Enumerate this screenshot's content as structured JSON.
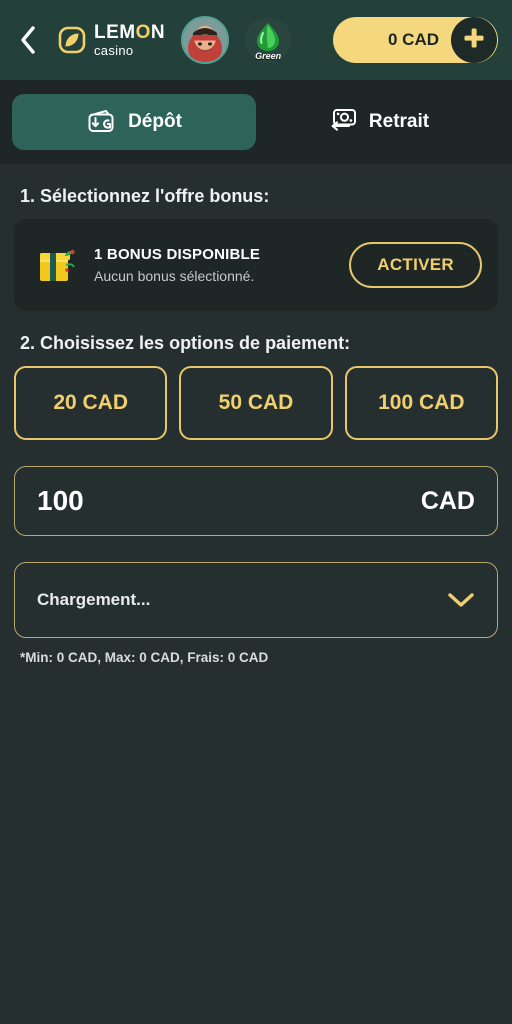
{
  "header": {
    "back_icon": "chevron-left-icon",
    "logo": {
      "mark_icon": "lemon-leaf-icon",
      "name_part1": "LEM",
      "name_o": "O",
      "name_part2": "N",
      "subtitle": "casino"
    },
    "avatar_icon": "user-avatar",
    "gem": {
      "icon": "green-gem-icon",
      "label": "Green"
    },
    "balance": {
      "amount": "0 CAD",
      "plus_icon": "plus-icon"
    }
  },
  "tabs": [
    {
      "id": "depot",
      "label": "Dépôt",
      "icon": "wallet-down-arrow-icon",
      "active": true
    },
    {
      "id": "retrait",
      "label": "Retrait",
      "icon": "banknote-left-arrow-icon",
      "active": false
    }
  ],
  "steps": {
    "step1_title": "1. Sélectionnez l'offre bonus:",
    "step2_title": "2. Choisissez les options de paiement:"
  },
  "bonus": {
    "icon": "gift-box-icon",
    "title": "1 BONUS DISPONIBLE",
    "subtitle": "Aucun bonus sélectionné.",
    "action_label": "ACTIVER"
  },
  "amount_presets": [
    {
      "label": "20 CAD"
    },
    {
      "label": "50 CAD"
    },
    {
      "label": "100 CAD"
    }
  ],
  "amount_input": {
    "value": "100",
    "placeholder": "100",
    "currency": "CAD"
  },
  "payment_select": {
    "value": "Chargement...",
    "chevron_icon": "chevron-down-icon"
  },
  "limits_note": "*Min: 0 CAD, Max: 0 CAD, Frais: 0 CAD",
  "colors": {
    "header_bg": "#23413a",
    "page_bg": "#262f2f",
    "panel_bg": "#1e2626",
    "accent_gold": "#f0cf6f",
    "accent_gold_border": "#e8c76b",
    "tab_active": "#2e6359",
    "balance_pill": "#f5d77d"
  }
}
